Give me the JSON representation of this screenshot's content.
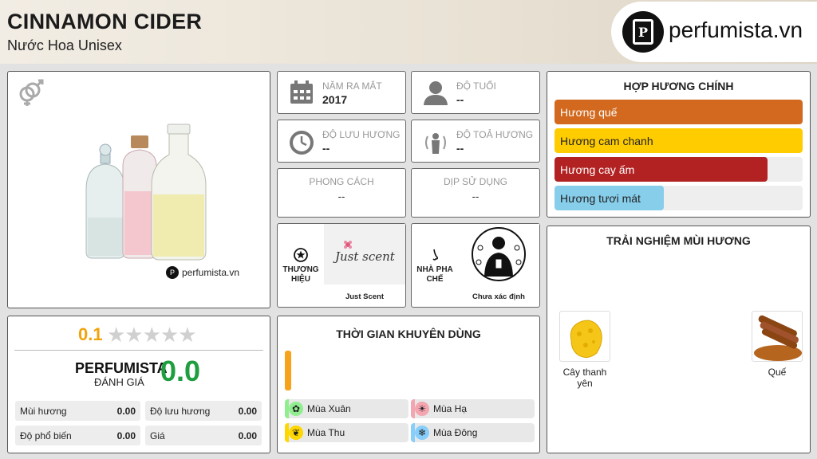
{
  "header": {
    "title": "CINNAMON CIDER",
    "subtitle": "Nước Hoa Unisex",
    "logo_text": "perfumista.vn"
  },
  "product": {
    "watermark": "perfumista.vn",
    "gender_icon": "male-female-icon"
  },
  "info": {
    "release_label": "NĂM RA MẮT",
    "release_value": "2017",
    "age_label": "ĐỘ TUỔI",
    "age_value": "--",
    "longevity_label": "ĐỘ LƯU HƯƠNG",
    "longevity_value": "--",
    "sillage_label": "ĐỘ TOẢ HƯƠNG",
    "sillage_value": "--",
    "style_label": "PHONG CÁCH",
    "style_value": "--",
    "occasion_label": "DỊP SỬ DỤNG",
    "occasion_value": "--"
  },
  "brand": {
    "label": "THƯƠNG HIỆU",
    "name": "Just Scent",
    "logo_text": "Just scent"
  },
  "perfumer": {
    "label": "NHÀ PHA CHẾ",
    "name": "Chưa xác định"
  },
  "accords": {
    "title": "HỢP HƯƠNG CHÍNH",
    "items": [
      {
        "label": "Hương quế",
        "level": 1.0,
        "color": "#d2691e"
      },
      {
        "label": "Hương cam chanh",
        "level": 1.0,
        "color": "#ffcc00"
      },
      {
        "label": "Hương cay ấm",
        "level": 0.86,
        "color": "#b22222"
      },
      {
        "label": "Hương tươi mát",
        "level": 0.44,
        "color": "#87ceeb"
      }
    ]
  },
  "rating": {
    "score": "0.1",
    "stars": "★★★★★",
    "stars_filled": 0,
    "perfumista_label": "PERFUMISTA",
    "perfumista_sub": "ĐÁNH GIÁ",
    "perfumista_score": "0.0",
    "metrics": [
      {
        "label": "Mùi hương",
        "value": "0.00"
      },
      {
        "label": "Độ lưu hương",
        "value": "0.00"
      },
      {
        "label": "Độ phổ biến",
        "value": "0.00"
      },
      {
        "label": "Giá",
        "value": "0.00"
      }
    ]
  },
  "time": {
    "title": "THỜI GIAN KHUYÊN DÙNG",
    "seasons": [
      {
        "label": "Mùa Xuân",
        "color": "#90ee90",
        "icon": "flower-icon"
      },
      {
        "label": "Mùa Hạ",
        "color": "#f4a6b0",
        "icon": "sun-icon"
      },
      {
        "label": "Mùa Thu",
        "color": "#ffd700",
        "icon": "leaf-icon"
      },
      {
        "label": "Mùa Đông",
        "color": "#87cefa",
        "icon": "snowflake-icon"
      }
    ]
  },
  "notes": {
    "title": "TRẢI NGHIỆM MÙI HƯƠNG",
    "items": [
      {
        "label": "Cây thanh yên",
        "icon": "citron-icon"
      },
      {
        "label": "Quế",
        "icon": "cinnamon-icon"
      }
    ]
  }
}
